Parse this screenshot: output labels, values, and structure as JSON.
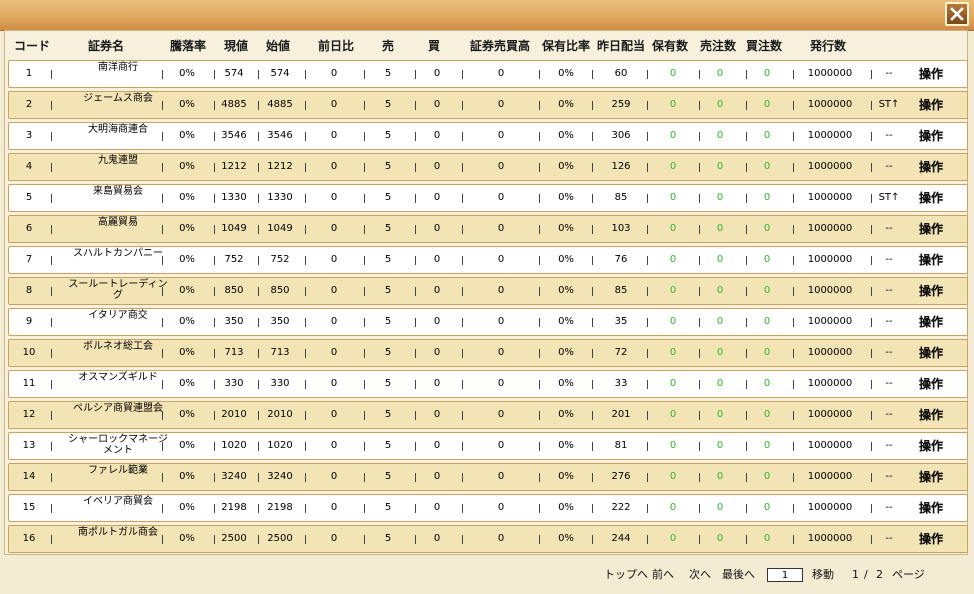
{
  "window": {
    "close_label": ""
  },
  "headers": [
    "コード",
    "証券名",
    "騰落率",
    "現値",
    "始値",
    "前日比",
    "売",
    "買",
    "証券売買高",
    "保有比率",
    "昨日配当",
    "保有数",
    "売注数",
    "買注数",
    "発行数"
  ],
  "colors": {
    "green_value": "#2db52d",
    "row_even": "#f3e4b5",
    "row_odd": "#ffffff",
    "title_bar": "#e0a860"
  },
  "op_label": "操作",
  "rows": [
    {
      "code": "1",
      "name": "南洋商行",
      "rate": "0%",
      "price": "574",
      "open": "574",
      "diff": "0",
      "sell": "5",
      "buy": "0",
      "volume": "0",
      "hold_ratio": "0%",
      "dividend": "60",
      "held": "0",
      "sell_orders": "0",
      "buy_orders": "0",
      "issued": "1000000",
      "status": "--"
    },
    {
      "code": "2",
      "name": "ジェームス商会",
      "rate": "0%",
      "price": "4885",
      "open": "4885",
      "diff": "0",
      "sell": "5",
      "buy": "0",
      "volume": "0",
      "hold_ratio": "0%",
      "dividend": "259",
      "held": "0",
      "sell_orders": "0",
      "buy_orders": "0",
      "issued": "1000000",
      "status": "ST↑"
    },
    {
      "code": "3",
      "name": "大明海商連合",
      "rate": "0%",
      "price": "3546",
      "open": "3546",
      "diff": "0",
      "sell": "5",
      "buy": "0",
      "volume": "0",
      "hold_ratio": "0%",
      "dividend": "306",
      "held": "0",
      "sell_orders": "0",
      "buy_orders": "0",
      "issued": "1000000",
      "status": "--"
    },
    {
      "code": "4",
      "name": "九鬼連盟",
      "rate": "0%",
      "price": "1212",
      "open": "1212",
      "diff": "0",
      "sell": "5",
      "buy": "0",
      "volume": "0",
      "hold_ratio": "0%",
      "dividend": "126",
      "held": "0",
      "sell_orders": "0",
      "buy_orders": "0",
      "issued": "1000000",
      "status": "--"
    },
    {
      "code": "5",
      "name": "来島貿易会",
      "rate": "0%",
      "price": "1330",
      "open": "1330",
      "diff": "0",
      "sell": "5",
      "buy": "0",
      "volume": "0",
      "hold_ratio": "0%",
      "dividend": "85",
      "held": "0",
      "sell_orders": "0",
      "buy_orders": "0",
      "issued": "1000000",
      "status": "ST↑"
    },
    {
      "code": "6",
      "name": "高麗貿易",
      "rate": "0%",
      "price": "1049",
      "open": "1049",
      "diff": "0",
      "sell": "5",
      "buy": "0",
      "volume": "0",
      "hold_ratio": "0%",
      "dividend": "103",
      "held": "0",
      "sell_orders": "0",
      "buy_orders": "0",
      "issued": "1000000",
      "status": "--"
    },
    {
      "code": "7",
      "name": "スハルトカンパニー",
      "rate": "0%",
      "price": "752",
      "open": "752",
      "diff": "0",
      "sell": "5",
      "buy": "0",
      "volume": "0",
      "hold_ratio": "0%",
      "dividend": "76",
      "held": "0",
      "sell_orders": "0",
      "buy_orders": "0",
      "issued": "1000000",
      "status": "--"
    },
    {
      "code": "8",
      "name": "スールートレーディング",
      "rate": "0%",
      "price": "850",
      "open": "850",
      "diff": "0",
      "sell": "5",
      "buy": "0",
      "volume": "0",
      "hold_ratio": "0%",
      "dividend": "85",
      "held": "0",
      "sell_orders": "0",
      "buy_orders": "0",
      "issued": "1000000",
      "status": "--"
    },
    {
      "code": "9",
      "name": "イタリア商交",
      "rate": "0%",
      "price": "350",
      "open": "350",
      "diff": "0",
      "sell": "5",
      "buy": "0",
      "volume": "0",
      "hold_ratio": "0%",
      "dividend": "35",
      "held": "0",
      "sell_orders": "0",
      "buy_orders": "0",
      "issued": "1000000",
      "status": "--"
    },
    {
      "code": "10",
      "name": "ボルネオ総工会",
      "rate": "0%",
      "price": "713",
      "open": "713",
      "diff": "0",
      "sell": "5",
      "buy": "0",
      "volume": "0",
      "hold_ratio": "0%",
      "dividend": "72",
      "held": "0",
      "sell_orders": "0",
      "buy_orders": "0",
      "issued": "1000000",
      "status": "--"
    },
    {
      "code": "11",
      "name": "オスマンズギルド",
      "rate": "0%",
      "price": "330",
      "open": "330",
      "diff": "0",
      "sell": "5",
      "buy": "0",
      "volume": "0",
      "hold_ratio": "0%",
      "dividend": "33",
      "held": "0",
      "sell_orders": "0",
      "buy_orders": "0",
      "issued": "1000000",
      "status": "--"
    },
    {
      "code": "12",
      "name": "ペルシア商貿連盟会",
      "rate": "0%",
      "price": "2010",
      "open": "2010",
      "diff": "0",
      "sell": "5",
      "buy": "0",
      "volume": "0",
      "hold_ratio": "0%",
      "dividend": "201",
      "held": "0",
      "sell_orders": "0",
      "buy_orders": "0",
      "issued": "1000000",
      "status": "--"
    },
    {
      "code": "13",
      "name": "シャーロックマネージメント",
      "rate": "0%",
      "price": "1020",
      "open": "1020",
      "diff": "0",
      "sell": "5",
      "buy": "0",
      "volume": "0",
      "hold_ratio": "0%",
      "dividend": "81",
      "held": "0",
      "sell_orders": "0",
      "buy_orders": "0",
      "issued": "1000000",
      "status": "--"
    },
    {
      "code": "14",
      "name": "ファレル範業",
      "rate": "0%",
      "price": "3240",
      "open": "3240",
      "diff": "0",
      "sell": "5",
      "buy": "0",
      "volume": "0",
      "hold_ratio": "0%",
      "dividend": "276",
      "held": "0",
      "sell_orders": "0",
      "buy_orders": "0",
      "issued": "1000000",
      "status": "--"
    },
    {
      "code": "15",
      "name": "イベリア商貿会",
      "rate": "0%",
      "price": "2198",
      "open": "2198",
      "diff": "0",
      "sell": "5",
      "buy": "0",
      "volume": "0",
      "hold_ratio": "0%",
      "dividend": "222",
      "held": "0",
      "sell_orders": "0",
      "buy_orders": "0",
      "issued": "1000000",
      "status": "--"
    },
    {
      "code": "16",
      "name": "南ポルトガル商会",
      "rate": "0%",
      "price": "2500",
      "open": "2500",
      "diff": "0",
      "sell": "5",
      "buy": "0",
      "volume": "0",
      "hold_ratio": "0%",
      "dividend": "244",
      "held": "0",
      "sell_orders": "0",
      "buy_orders": "0",
      "issued": "1000000",
      "status": "--"
    }
  ],
  "pager": {
    "top": "トップへ",
    "prev": "前へ",
    "next": "次へ",
    "last": "最後へ",
    "page_input_value": "1",
    "go": "移動",
    "current": "1",
    "slash": "/",
    "total": "2",
    "page_label": "ページ"
  }
}
